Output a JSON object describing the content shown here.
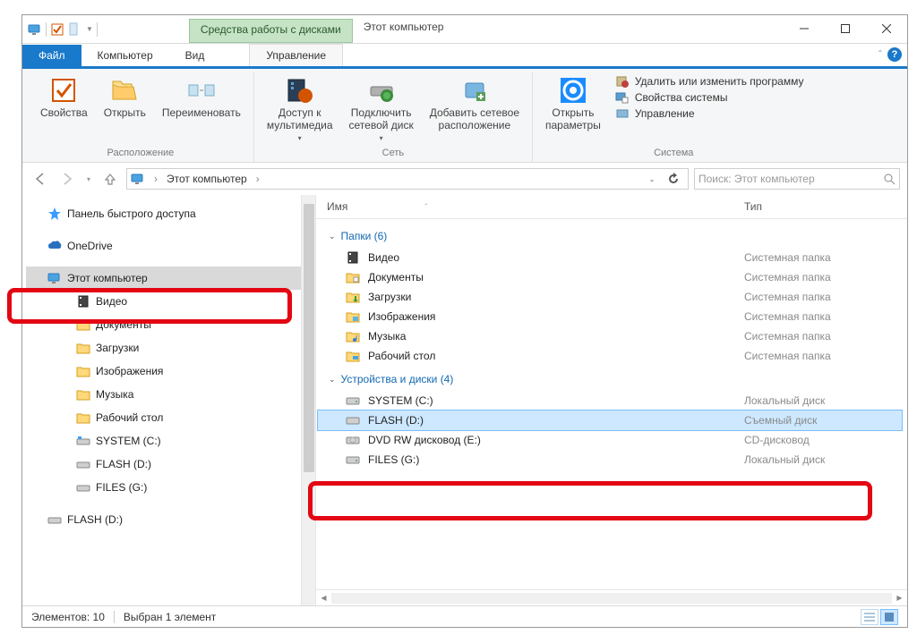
{
  "titlebar": {
    "context_tab": "Средства работы с дисками",
    "title": "Этот компьютер"
  },
  "ribbon": {
    "file": "Файл",
    "computer": "Компьютер",
    "view": "Вид",
    "sub": "Управление",
    "location": {
      "properties": "Свойства",
      "open": "Открыть",
      "rename": "Переименовать",
      "label": "Расположение"
    },
    "network": {
      "media_access": "Доступ к\nмультимедиа",
      "map_drive": "Подключить\nсетевой диск",
      "add_netloc": "Добавить сетевое\nрасположение",
      "label": "Сеть"
    },
    "system": {
      "open_params": "Открыть\nпараметры",
      "uninstall": "Удалить или изменить программу",
      "sysprops": "Свойства системы",
      "manage": "Управление",
      "label": "Система"
    }
  },
  "address": {
    "path": "Этот компьютер",
    "search_placeholder": "Поиск: Этот компьютер"
  },
  "nav": {
    "quick": "Панель быстрого доступа",
    "onedrive": "OneDrive",
    "thispc": "Этот компьютер",
    "video": "Видео",
    "documents": "Документы",
    "downloads": "Загрузки",
    "pictures": "Изображения",
    "music": "Музыка",
    "desktop": "Рабочий стол",
    "system_c": "SYSTEM (C:)",
    "flash_d": "FLASH (D:)",
    "files_g": "FILES (G:)",
    "flash_d2": "FLASH (D:)"
  },
  "columns": {
    "name": "Имя",
    "type": "Тип"
  },
  "groups": {
    "folders": "Папки (6)",
    "devices": "Устройства и диски (4)"
  },
  "items": {
    "folders": [
      {
        "name": "Видео",
        "type": "Системная папка",
        "icon": "film"
      },
      {
        "name": "Документы",
        "type": "Системная папка",
        "icon": "doc"
      },
      {
        "name": "Загрузки",
        "type": "Системная папка",
        "icon": "down"
      },
      {
        "name": "Изображения",
        "type": "Системная папка",
        "icon": "pic"
      },
      {
        "name": "Музыка",
        "type": "Системная папка",
        "icon": "music"
      },
      {
        "name": "Рабочий стол",
        "type": "Системная папка",
        "icon": "desk"
      }
    ],
    "devices": [
      {
        "name": "SYSTEM (C:)",
        "type": "Локальный диск",
        "icon": "hdd"
      },
      {
        "name": "FLASH (D:)",
        "type": "Съемный диск",
        "icon": "usb",
        "selected": true
      },
      {
        "name": "DVD RW дисковод (E:)",
        "type": "CD-дисковод",
        "icon": "dvd"
      },
      {
        "name": "FILES (G:)",
        "type": "Локальный диск",
        "icon": "hdd"
      }
    ]
  },
  "status": {
    "count": "Элементов: 10",
    "selection": "Выбран 1 элемент"
  }
}
